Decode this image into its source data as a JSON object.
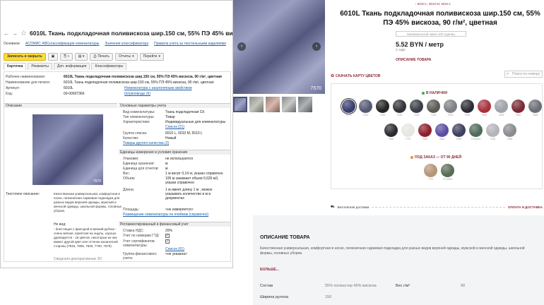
{
  "erp": {
    "back": "←",
    "forward": "→",
    "title": "6010L Ткань подкладочная поливискоза  шир.150 см, 55% ПЭ 45% вискоза, 90 г/",
    "links": [
      "Основное",
      "АСОМИС АВСклассификация номенклатуры",
      "Значения классификатора",
      "Правила учета за текстильными изделиями"
    ],
    "toolbar": {
      "save": "Записать и закрыть",
      "print": "Печать",
      "reports": "Отчеты",
      "goto": "Перейти"
    },
    "tabs": [
      "Карточка",
      "Реквизиты",
      "Доп. информация",
      "Классификаторы"
    ],
    "fields": {
      "work_name_k": "Рабочее наименование:",
      "work_name_v": "6010L Ткань подкладочная поливискоза  шир.150 см, 55% ПЭ 45% вискоза, 90 г/м², цветная",
      "print_name_k": "Наименование для печати:",
      "print_name_v": "6010L Ткань подкладочная поливискоза  шир.150 см, 55% ПЭ 45% вискоза, 90 г/м², цветная",
      "article_k": "Артикул:",
      "article_v": "6010L",
      "code_k": "Код:",
      "code_v": "00-00007366",
      "right_link1": "Номенклатура с аналогичным свойством",
      "right_link2": "Штриховоды (6)",
      "sect_descr": "Описание",
      "sect_params": "Основные параметры учета",
      "type_k": "Вид номенклатуры:",
      "type_v": "Ткань подкладочная СК",
      "kind_k": "Тип номенклатуры:",
      "kind_v": "Товар",
      "char_k": "Характеристики:",
      "char_v": "Индивидуальные для номенклатуры",
      "char_link": "Список (21)",
      "group_k": "Группа списка:",
      "group_v": "6010 L, 6010 M, 5010 L",
      "quality_k": "Качество:",
      "quality_v": "Новый",
      "quality_link": "Товары другого качества (2)",
      "sect_units": "Единицы измерения и условия хранения",
      "pack_k": "Упаковки:",
      "pack_v": "не используются",
      "store_unit_k": "Единица хранения:",
      "store_unit_v": "м",
      "report_unit_k": "Единица для отчетов:",
      "report_unit_v": "м",
      "weight_k": "Вес:",
      "weight_v": "1 м  весит 0,14 кг, указан справочно",
      "volume_k": "Объем:",
      "volume_v": "100 м  занимает объем 0,626 м3, указан справочно",
      "length_k": "Длина:",
      "length_v": "1 м  имеет длину 1 м , можно указывать количество в  м  в документах",
      "text_descr_k": "Текстовое описание:",
      "text_descr_v": "Качественная универсальная, комфортная в носке, гигиеничная саржевая подкладка для разных видов верхней одежды, мужской и женской одежды, школьной формы, головных уборов.",
      "view_k": "Не вид:",
      "bullets": "- блестящая с фактурой в мелкий рубчик - очень мягкая, приятная на ощупь, хорошо драпируется - 16 цветов, некоторые из них имеют другой цвет или оттенок изнаночной стороны (7815, 7805, 7840, 7700, 7570)",
      "extra_k": "Сведения декларативные 3D",
      "place_k": "Площадь:",
      "place_v": "<не измеряется>",
      "place_link": "Размещение номенклатуры по ячейкам (справочно)",
      "sect_reg": "Регламентированный и финансовый учет",
      "vat_k": "Ставка НДС:",
      "vat_v": "20%",
      "gtd_k": "Учет по номерам ГТД:",
      "cert_k": "Учет сертификатов номенклатуры:",
      "cert_link": "Список (61)",
      "fin_k": "Группа финансового учета:",
      "fin_v": "<не указана>",
      "img_code": "7570"
    }
  },
  "gallery": {
    "prev": "‹",
    "next": "›",
    "code": "7570"
  },
  "card": {
    "crumb": "6010 L, 6010 M, 5010 L",
    "title": "6010L Ткань подкладочная поливискоза шир.150 см, 55% ПЭ 45% вискоза, 90 г/м², цветная",
    "min_order": "Минимальный заказ 100 единиц",
    "price": "5.52 BYN / метр",
    "vat": "С НДС",
    "desc_link": "ОПИСАНИЕ ТОВАРА",
    "color_link": "СКАЧАТЬ КАРТУ ЦВЕТОВ",
    "search_placeholder": "Поиск по номеру",
    "in_stock": "В НАЛИЧИИ",
    "on_order": "ПОД ЗАКАЗ — ОТ 90 ДНЕЙ",
    "row1": [
      {
        "n": "7570",
        "c": "#3a3f6e",
        "sel": true
      },
      {
        "n": "7040",
        "c": "#555a74"
      },
      {
        "n": "7045",
        "c": "#242424"
      },
      {
        "n": "7040",
        "c": "#333338"
      },
      {
        "n": "7225",
        "c": "#3a3e46"
      },
      {
        "n": "7120",
        "c": "#5c5a55"
      },
      {
        "n": "7570",
        "c": "#7e8085"
      },
      {
        "n": "7040",
        "c": "#2b2d33"
      },
      {
        "n": "7845",
        "c": "#a8323c"
      },
      {
        "n": "7815",
        "c": "#9fa4aa"
      },
      {
        "n": "7800",
        "c": "#7a2a34"
      },
      {
        "n": "7580",
        "c": "#6c6f78"
      }
    ],
    "row2": [
      {
        "n": "7060",
        "c": "#2a2c30"
      },
      {
        "n": "7770",
        "c": "#e8e6e1"
      },
      {
        "n": "7500",
        "c": "#8d1f2a"
      },
      {
        "n": "7840",
        "c": "#5a4fa3"
      },
      {
        "n": "7040",
        "c": "#3d4060"
      },
      {
        "n": "TH-6022",
        "c": "#4f6b5a"
      },
      {
        "n": "7030",
        "c": "#b2b4b8"
      },
      {
        "n": "7550",
        "c": "#8a8c90"
      }
    ],
    "row3": [
      {
        "n": "7770",
        "c": "#b59677"
      },
      {
        "n": "TH-6503",
        "c": "#5b6b56"
      }
    ],
    "delivery": "Бесплатная доставка",
    "payment": "ОПЛАТА И ДОСТАВКА",
    "stock_green": "#3caa5a",
    "stock_orange": "#e0913a"
  },
  "description": {
    "heading": "ОПИСАНИЕ ТОВАРА",
    "text": "Качественная универсальная, комфортная в носке, гигиеничная саржевая подкладка для разных видов верхней одежды, мужской и женской одежды, школьной формы, головных уборов.",
    "more": "БОЛЬШЕ...",
    "spec1_k": "Состав",
    "spec1_v": "55% полиэстер 45% вискоза",
    "spec2_k": "Вес г/м²",
    "spec2_v": "90",
    "spec3_k": "Ширина рулона",
    "spec3_v": "150"
  }
}
